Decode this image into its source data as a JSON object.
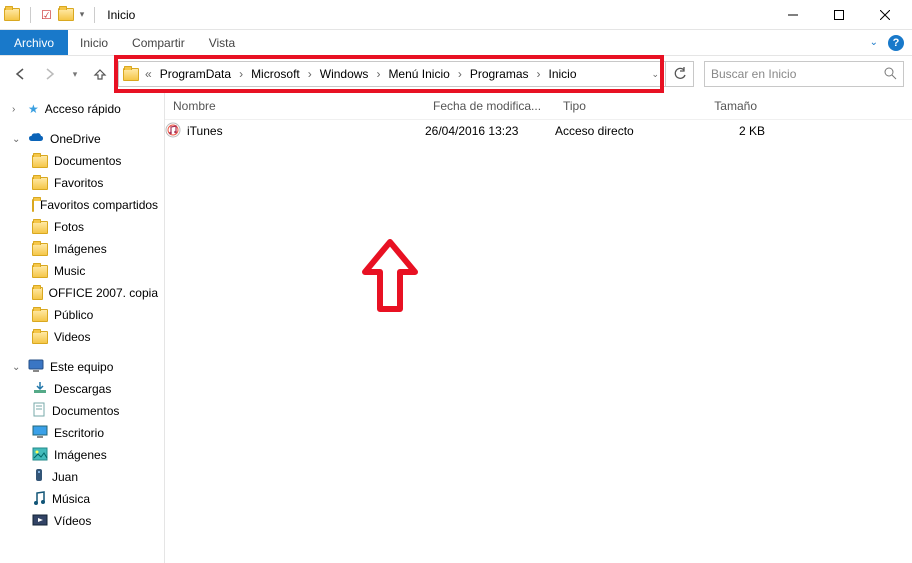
{
  "window": {
    "title": "Inicio"
  },
  "menubar": {
    "archivo": "Archivo",
    "items": [
      "Inicio",
      "Compartir",
      "Vista"
    ]
  },
  "breadcrumb": [
    "ProgramData",
    "Microsoft",
    "Windows",
    "Menú Inicio",
    "Programas",
    "Inicio"
  ],
  "search": {
    "placeholder": "Buscar en Inicio"
  },
  "columns": {
    "name": "Nombre",
    "date": "Fecha de modifica...",
    "type": "Tipo",
    "size": "Tamaño"
  },
  "files": [
    {
      "name": "iTunes",
      "date": "26/04/2016 13:23",
      "type": "Acceso directo",
      "size": "2 KB"
    }
  ],
  "sidebar": {
    "quick": {
      "label": "Acceso rápido"
    },
    "onedrive": {
      "label": "OneDrive",
      "children": [
        "Documentos",
        "Favoritos",
        "Favoritos compartidos",
        "Fotos",
        "Imágenes",
        "Music",
        "OFFICE 2007. copia",
        "Público",
        "Videos"
      ]
    },
    "pc": {
      "label": "Este equipo",
      "children": [
        "Descargas",
        "Documentos",
        "Escritorio",
        "Imágenes",
        "Juan",
        "Música",
        "Vídeos"
      ]
    }
  }
}
